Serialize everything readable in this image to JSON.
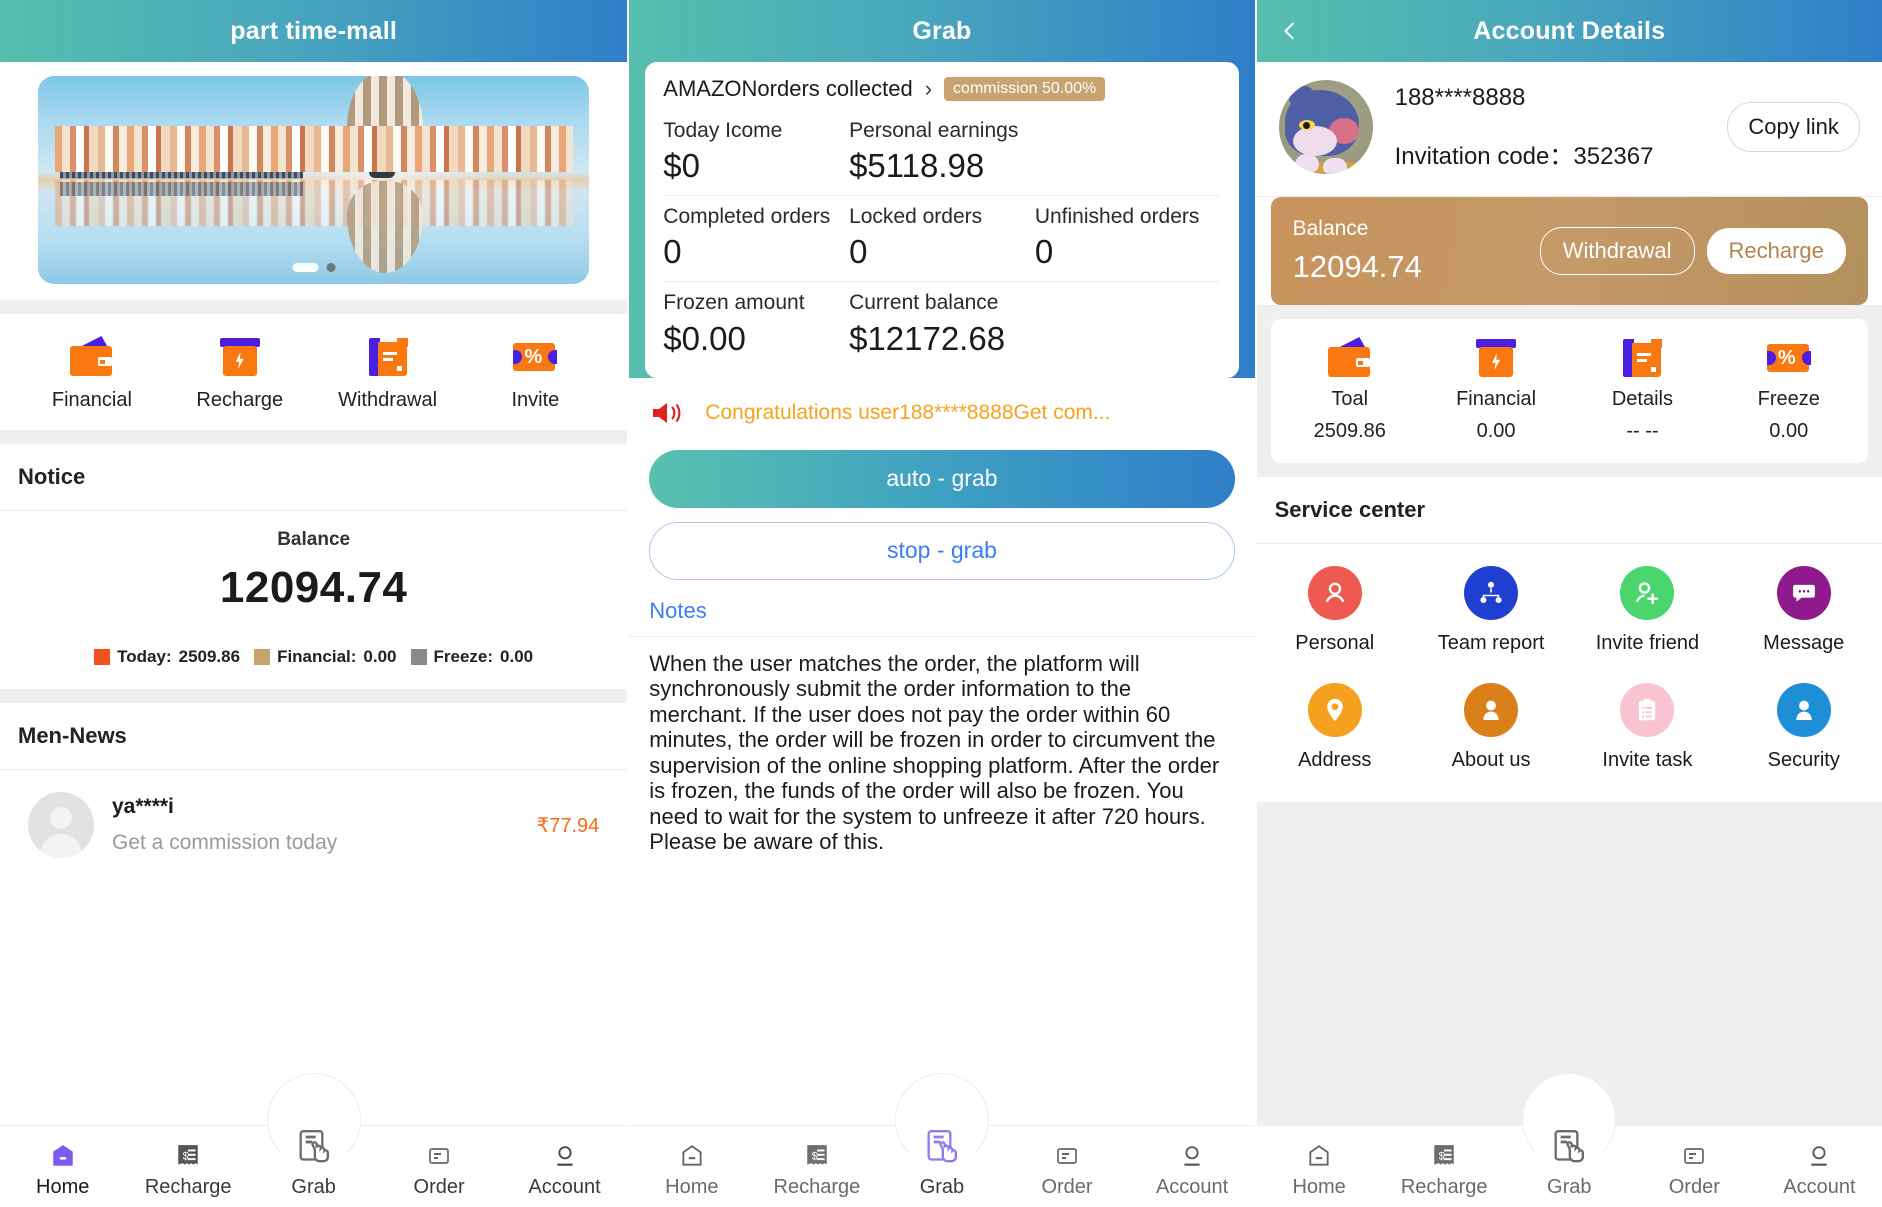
{
  "screen1": {
    "header": {
      "title": "part time-mall"
    },
    "banner": {
      "dots": 2,
      "active_dot": 0
    },
    "quick_actions": [
      {
        "label": "Financial",
        "icon": "wallet-icon"
      },
      {
        "label": "Recharge",
        "icon": "recharge-icon"
      },
      {
        "label": "Withdrawal",
        "icon": "withdrawal-icon"
      },
      {
        "label": "Invite",
        "icon": "invite-percent-icon"
      }
    ],
    "notice_title": "Notice",
    "balance": {
      "label": "Balance",
      "amount": "12094.74"
    },
    "legend": [
      {
        "label": "Today:",
        "value": "2509.86",
        "color": "#f4511e"
      },
      {
        "label": "Financial:",
        "value": "0.00",
        "color": "#c8a271"
      },
      {
        "label": "Freeze:",
        "value": "0.00",
        "color": "#8a8a8a"
      }
    ],
    "news_title": "Men-News",
    "news_item": {
      "name": "ya****i",
      "subtitle": "Get a commission today",
      "amount": "₹77.94",
      "amount_color": "#f96a1b"
    },
    "tabs": [
      {
        "label": "Home",
        "icon": "home-icon",
        "active": true
      },
      {
        "label": "Recharge",
        "icon": "receipt-dollar-icon",
        "active": false
      },
      {
        "label": "Grab",
        "icon": "tap-document-icon",
        "active": false
      },
      {
        "label": "Order",
        "icon": "order-doc-icon",
        "active": false
      },
      {
        "label": "Account",
        "icon": "account-person-icon",
        "active": false
      }
    ]
  },
  "screen2": {
    "header": {
      "title": "Grab"
    },
    "card": {
      "source_label": "AMAZONorders collected",
      "chevron": "›",
      "commission_badge": "commission 50.00%",
      "rows": [
        [
          {
            "key": "Today Icome",
            "value": "$0"
          },
          {
            "key": "Personal earnings",
            "value": "$5118.98"
          }
        ],
        [
          {
            "key": "Completed orders",
            "value": "0"
          },
          {
            "key": "Locked orders",
            "value": "0"
          },
          {
            "key": "Unfinished orders",
            "value": "0"
          }
        ],
        [
          {
            "key": "Frozen amount",
            "value": "$0.00"
          },
          {
            "key": "Current balance",
            "value": "$12172.68"
          }
        ]
      ]
    },
    "marquee": {
      "icon": "speaker-icon",
      "text": "Congratulations user188****8888Get com..."
    },
    "buttons": {
      "primary": "auto - grab",
      "outline": "stop - grab"
    },
    "notes_title": "Notes",
    "notes_body": "When the user matches the order, the platform will synchronously submit the order information to the merchant.  If the user does not pay the order within 60  minutes, the order will be frozen in order to circumvent the supervision of the online shopping platform.  After the order is frozen, the funds of the order will also be frozen. You need to wait for the system to unfreeze it after 720 hours. Please be aware of this.",
    "tabs": [
      {
        "label": "Home",
        "icon": "home-icon",
        "active": false
      },
      {
        "label": "Recharge",
        "icon": "receipt-dollar-icon",
        "active": false
      },
      {
        "label": "Grab",
        "icon": "tap-document-icon",
        "active": true
      },
      {
        "label": "Order",
        "icon": "order-doc-icon",
        "active": false
      },
      {
        "label": "Account",
        "icon": "account-person-icon",
        "active": false
      }
    ]
  },
  "screen3": {
    "header": {
      "title": "Account Details",
      "back_icon": "chevron-left-icon"
    },
    "profile": {
      "avatar": "cat-avatar",
      "phone": "188****8888",
      "invitation_label": "Invitation code：",
      "invitation_code": "352367",
      "copy_button": "Copy link"
    },
    "balance_banner": {
      "label": "Balance",
      "amount": "12094.74",
      "withdrawal_button": "Withdrawal",
      "recharge_button": "Recharge",
      "bg_color": "#c4955f"
    },
    "stats": [
      {
        "label": "Toal",
        "value": "2509.86",
        "icon": "wallet-icon"
      },
      {
        "label": "Financial",
        "value": "0.00",
        "icon": "recharge-icon"
      },
      {
        "label": "Details",
        "value": "-- --",
        "icon": "withdrawal-icon"
      },
      {
        "label": "Freeze",
        "value": "0.00",
        "icon": "invite-percent-icon"
      }
    ],
    "service_center_title": "Service center",
    "services": [
      {
        "label": "Personal",
        "icon": "person-icon",
        "color": "#ee5a52"
      },
      {
        "label": "Team report",
        "icon": "team-network-icon",
        "color": "#1e3fd0"
      },
      {
        "label": "Invite friend",
        "icon": "person-add-icon",
        "color": "#4ad66d"
      },
      {
        "label": "Message",
        "icon": "chat-bubble-icon",
        "color": "#8e1a8e"
      },
      {
        "label": "Address",
        "icon": "location-pin-icon",
        "color": "#f5a01e"
      },
      {
        "label": "About us",
        "icon": "person-filled-icon",
        "color": "#d9801a"
      },
      {
        "label": "Invite task",
        "icon": "clipboard-icon",
        "color": "#f9c3d2"
      },
      {
        "label": "Security",
        "icon": "person-shield-icon",
        "color": "#1e8ed6"
      }
    ],
    "tabs": [
      {
        "label": "Home",
        "icon": "home-icon",
        "active": false
      },
      {
        "label": "Recharge",
        "icon": "receipt-dollar-icon",
        "active": false
      },
      {
        "label": "Grab",
        "icon": "tap-document-icon",
        "active": false
      },
      {
        "label": "Order",
        "icon": "order-doc-icon",
        "active": false
      },
      {
        "label": "Account",
        "icon": "account-person-icon",
        "active": false
      }
    ]
  }
}
